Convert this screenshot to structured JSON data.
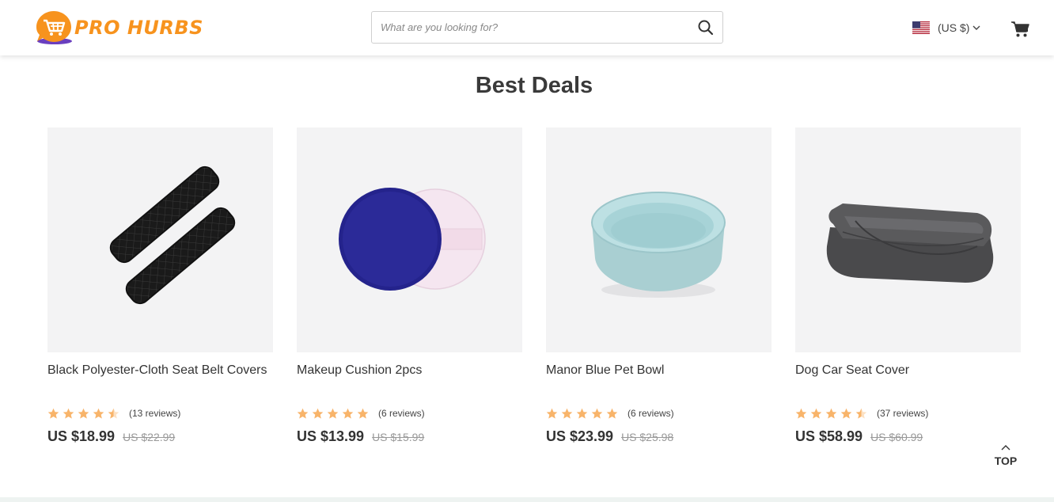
{
  "header": {
    "logo_text": "PRO HURBS",
    "search_placeholder": "What are you looking for?",
    "currency_label": "(US $)",
    "brand_color": "#f7931e"
  },
  "section": {
    "title": "Best Deals"
  },
  "products": [
    {
      "title": "Black Polyester-Cloth Seat Belt Covers",
      "rating": 4.5,
      "reviews": "(13 reviews)",
      "price": "US $18.99",
      "old_price": "US $22.99",
      "image": "seat-belt-covers"
    },
    {
      "title": "Makeup Cushion 2pcs",
      "rating": 5,
      "reviews": "(6 reviews)",
      "price": "US $13.99",
      "old_price": "US $15.99",
      "image": "makeup-cushions"
    },
    {
      "title": "Manor Blue Pet Bowl",
      "rating": 5,
      "reviews": "(6 reviews)",
      "price": "US $23.99",
      "old_price": "US $25.98",
      "image": "pet-bowl"
    },
    {
      "title": "Dog Car Seat Cover",
      "rating": 4.5,
      "reviews": "(37 reviews)",
      "price": "US $58.99",
      "old_price": "US $60.99",
      "image": "seat-cover"
    }
  ],
  "back_to_top": {
    "label": "TOP"
  },
  "colors": {
    "star": "#f8b46a",
    "image_bg": "#f3f3f4",
    "price": "#333333",
    "old_price": "#999999"
  }
}
